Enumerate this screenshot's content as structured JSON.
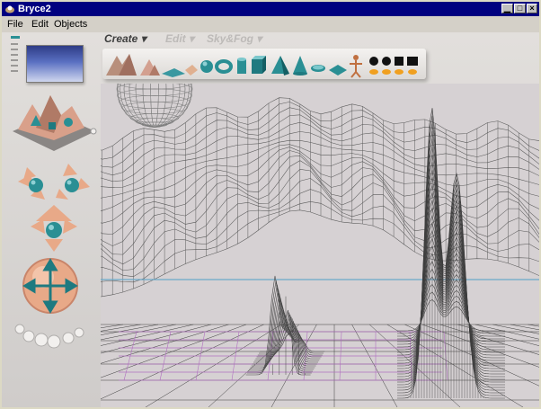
{
  "window": {
    "title": "Bryce2",
    "controls": [
      "minimize",
      "maximize",
      "close"
    ]
  },
  "menu": {
    "items": [
      "File",
      "Edit",
      "Objects"
    ]
  },
  "palettes": {
    "tabs": [
      "Create",
      "Edit",
      "Sky&Fog"
    ]
  },
  "create_tools": [
    "terrain-icon",
    "symmetrical-lattice-icon",
    "water-plane-icon",
    "infinite-plane-icon",
    "sphere-icon",
    "torus-icon",
    "cylinder-icon",
    "cube-icon",
    "pyramid-icon",
    "cone-icon",
    "disk-icon",
    "square-icon",
    "light-icon",
    "2d-picture-icon"
  ],
  "colors": {
    "title_bar": "#000080",
    "viewport": "#d6d1d3",
    "wireframe": "#5a5a5a",
    "horizon_line": "#6aa9c9",
    "ground_grid": "#b070c0",
    "tool_teal": "#2a8f94",
    "control_peach": "#e8a988"
  }
}
